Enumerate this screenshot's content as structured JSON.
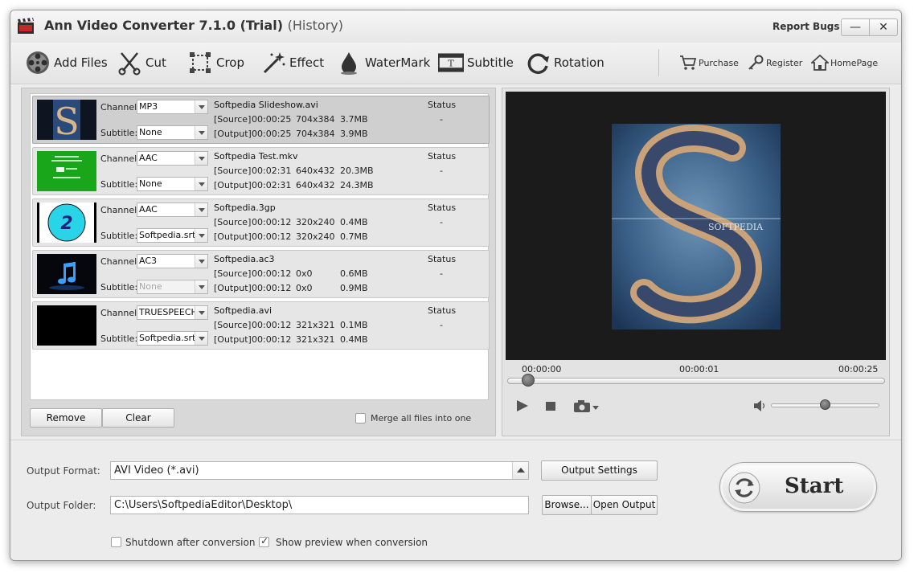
{
  "window": {
    "title": "Ann Video Converter 7.1.0 (Trial)",
    "title_suffix": "(History)",
    "report_bugs": "Report Bugs",
    "minimize_glyph": "—",
    "close_glyph": "✕"
  },
  "toolbar": {
    "add_files": "Add Files",
    "cut": "Cut",
    "crop": "Crop",
    "effect": "Effect",
    "watermark": "WaterMark",
    "subtitle": "Subtitle",
    "rotation": "Rotation",
    "purchase": "Purchase",
    "register": "Register",
    "homepage": "HomePage"
  },
  "list": {
    "channel_label": "Channel:",
    "subtitle_label": "Subtitle:",
    "status_label": "Status",
    "files": [
      {
        "name": "Softpedia Slideshow.avi",
        "channel": "MP3",
        "subtitle": "None",
        "subtitle_disabled": false,
        "status": "-",
        "source": {
          "tag": "[Source]",
          "duration": "00:00:25",
          "resolution": "704x384",
          "size": "3.7MB"
        },
        "output": {
          "tag": "[Output]",
          "duration": "00:00:25",
          "resolution": "704x384",
          "size": "3.9MB"
        }
      },
      {
        "name": "Softpedia Test.mkv",
        "channel": "AAC",
        "subtitle": "None",
        "subtitle_disabled": false,
        "status": "-",
        "source": {
          "tag": "[Source]",
          "duration": "00:02:31",
          "resolution": "640x432",
          "size": "20.3MB"
        },
        "output": {
          "tag": "[Output]",
          "duration": "00:02:31",
          "resolution": "640x432",
          "size": "24.3MB"
        }
      },
      {
        "name": "Softpedia.3gp",
        "channel": "AAC",
        "subtitle": "Softpedia.srt",
        "subtitle_disabled": false,
        "status": "-",
        "source": {
          "tag": "[Source]",
          "duration": "00:00:12",
          "resolution": "320x240",
          "size": "0.4MB"
        },
        "output": {
          "tag": "[Output]",
          "duration": "00:00:12",
          "resolution": "320x240",
          "size": "0.7MB"
        }
      },
      {
        "name": "Softpedia.ac3",
        "channel": "AC3",
        "subtitle": "None",
        "subtitle_disabled": true,
        "status": "-",
        "source": {
          "tag": "[Source]",
          "duration": "00:00:12",
          "resolution": "0x0",
          "size": "0.6MB"
        },
        "output": {
          "tag": "[Output]",
          "duration": "00:00:12",
          "resolution": "0x0",
          "size": "0.9MB"
        }
      },
      {
        "name": "Softpedia.avi",
        "channel": "TRUESPEECH",
        "subtitle": "Softpedia.srt",
        "subtitle_disabled": false,
        "status": "-",
        "source": {
          "tag": "[Source]",
          "duration": "00:00:12",
          "resolution": "321x321",
          "size": "0.1MB"
        },
        "output": {
          "tag": "[Output]",
          "duration": "00:00:12",
          "resolution": "321x321",
          "size": "0.4MB"
        }
      }
    ],
    "remove": "Remove",
    "clear": "Clear",
    "merge_label": "Merge all files into one",
    "merge_checked": false
  },
  "preview": {
    "time_start": "00:00:00",
    "time_current": "00:00:01",
    "time_end": "00:00:25",
    "seek_fraction": 0.04,
    "volume_fraction": 0.5
  },
  "bottom": {
    "output_format_label": "Output Format:",
    "output_format_value": "AVI Video (*.avi)",
    "output_settings": "Output Settings",
    "output_folder_label": "Output Folder:",
    "output_folder_value": "C:\\Users\\SoftpediaEditor\\Desktop\\",
    "browse": "Browse...",
    "open_output": "Open Output",
    "shutdown_label": "Shutdown after conversion",
    "shutdown_checked": false,
    "show_preview_label": "Show preview when conversion",
    "show_preview_checked": true,
    "start": "Start"
  },
  "colors": {
    "accent_green": "#1aa61a",
    "preview_cyan": "#29d3e8",
    "video_bg": "#1b1b1b"
  }
}
